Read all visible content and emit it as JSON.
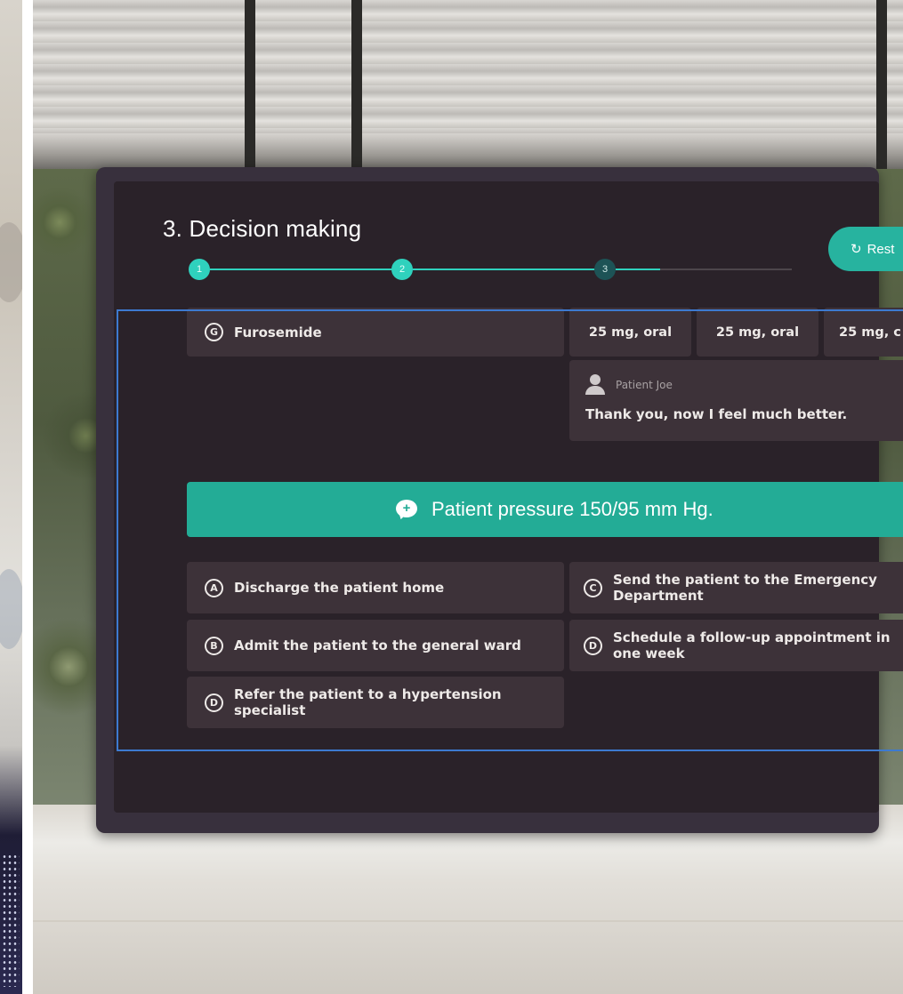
{
  "header": {
    "title": "3. Decision making",
    "restart_label": "Rest",
    "steps": [
      "1",
      "2",
      "3"
    ]
  },
  "medication": {
    "badge": "G",
    "name": "Furosemide",
    "doses": [
      "25 mg, oral",
      "25 mg, oral",
      "25 mg, c"
    ]
  },
  "patient_message": {
    "speaker": "Patient Joe",
    "text": "Thank you, now I feel much better."
  },
  "banner": {
    "text": "Patient pressure 150/95 mm Hg."
  },
  "options": [
    {
      "badge": "A",
      "text": "Discharge the patient home"
    },
    {
      "badge": "C",
      "text": "Send the patient to the Emergency Department"
    },
    {
      "badge": "B",
      "text": "Admit the patient to the general ward"
    },
    {
      "badge": "D",
      "text": "Schedule a follow-up appointment in one week"
    },
    {
      "badge": "D",
      "text": "Refer the patient to a hypertension specialist"
    }
  ],
  "colors": {
    "accent": "#27b39f",
    "panel": "#38303d",
    "card": "#3d3239",
    "selection_frame": "#3d7ad0"
  }
}
